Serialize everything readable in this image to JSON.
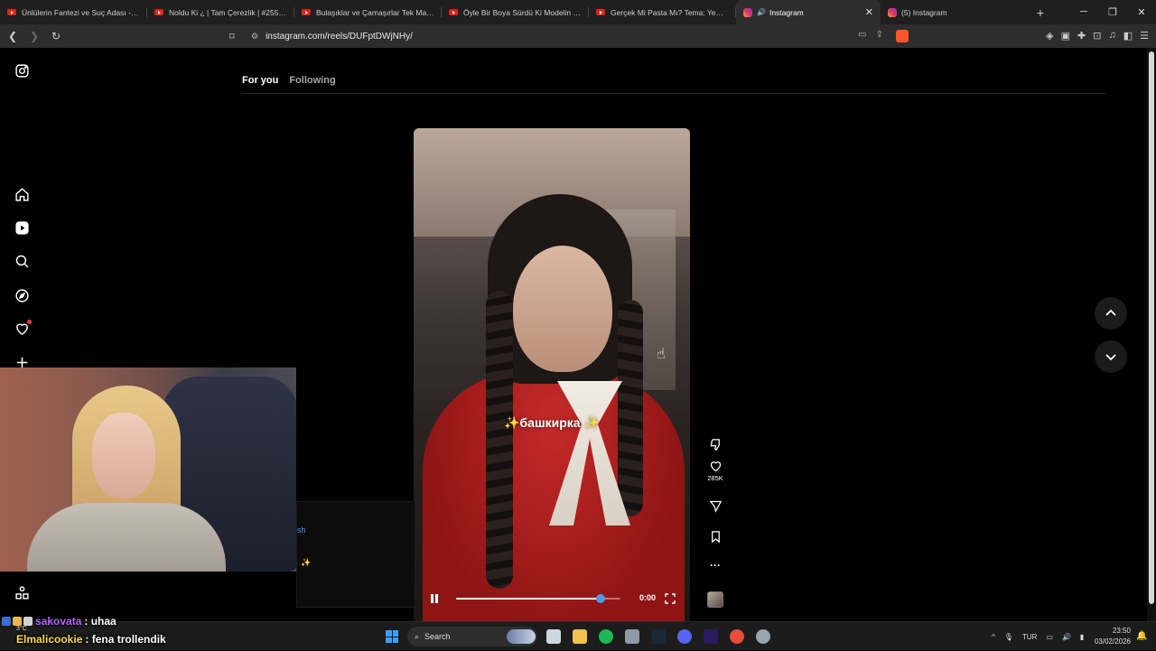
{
  "browser": {
    "tabs": [
      {
        "title": "Ünlülerin Fantezi ve Suç Adası - Jeffr",
        "icon": "youtube-icon"
      },
      {
        "title": "Noldu Ki ¿ | Tam Çerezlik | #255 - Yo",
        "icon": "youtube-icon"
      },
      {
        "title": "Bulaşıklar ve Çamaşırlar Tek Makined",
        "icon": "youtube-icon"
      },
      {
        "title": "Öyle Bir Boya Sürdü Ki Modelin Saçı",
        "icon": "youtube-icon"
      },
      {
        "title": "Gerçek Mi Pasta Mı? Tema: Yemekler",
        "icon": "youtube-icon"
      },
      {
        "title": "Instagram",
        "icon": "instagram-icon",
        "active": true
      },
      {
        "title": "(5) Instagram",
        "icon": "instagram-icon"
      }
    ],
    "new_tab": "+",
    "url": "instagram.com/reels/DUFptDWjNHy/"
  },
  "instagram": {
    "feed_tabs": {
      "for_you": "For you",
      "following": "Following"
    },
    "reel": {
      "caption": "✨башкирка ✨",
      "time": "0:00",
      "progress": 0.88
    },
    "actions": {
      "like_count": "285K",
      "more": "···"
    },
    "comment_panel": {
      "fragment1": "sh",
      "fragment2": "✨"
    }
  },
  "chat": [
    {
      "user": "sakovata",
      "message": ": uhaa"
    },
    {
      "user": "Elmalicookie",
      "message": ": fena trollendik"
    }
  ],
  "taskbar": {
    "search": "Search",
    "weather": "3°C",
    "language": "TUR",
    "time": "23:50",
    "date": "03/02/2026"
  },
  "colors": {
    "accent_blue": "#4d9be8",
    "like_dot": "#ff3040",
    "chat_user1": "#b364ff",
    "chat_user2": "#ffd84a"
  }
}
